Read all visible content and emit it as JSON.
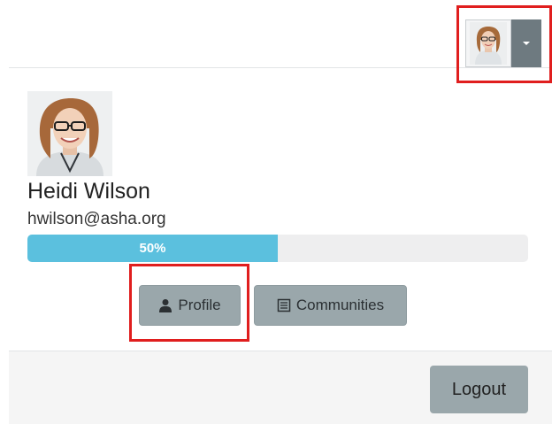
{
  "header": {
    "avatar_icon": "user-avatar",
    "dropdown_icon": "caret-down"
  },
  "profile": {
    "name": "Heidi Wilson",
    "email": "hwilson@asha.org",
    "completion": 0.5,
    "completion_label": "50%"
  },
  "actions": {
    "profile_label": "Profile",
    "profile_icon": "user-icon",
    "communities_label": "Communities",
    "communities_icon": "list-icon"
  },
  "footer": {
    "logout_label": "Logout"
  },
  "colors": {
    "progress": "#5bc0de",
    "button": "#9aa7ab",
    "highlight": "#e01e1e"
  }
}
